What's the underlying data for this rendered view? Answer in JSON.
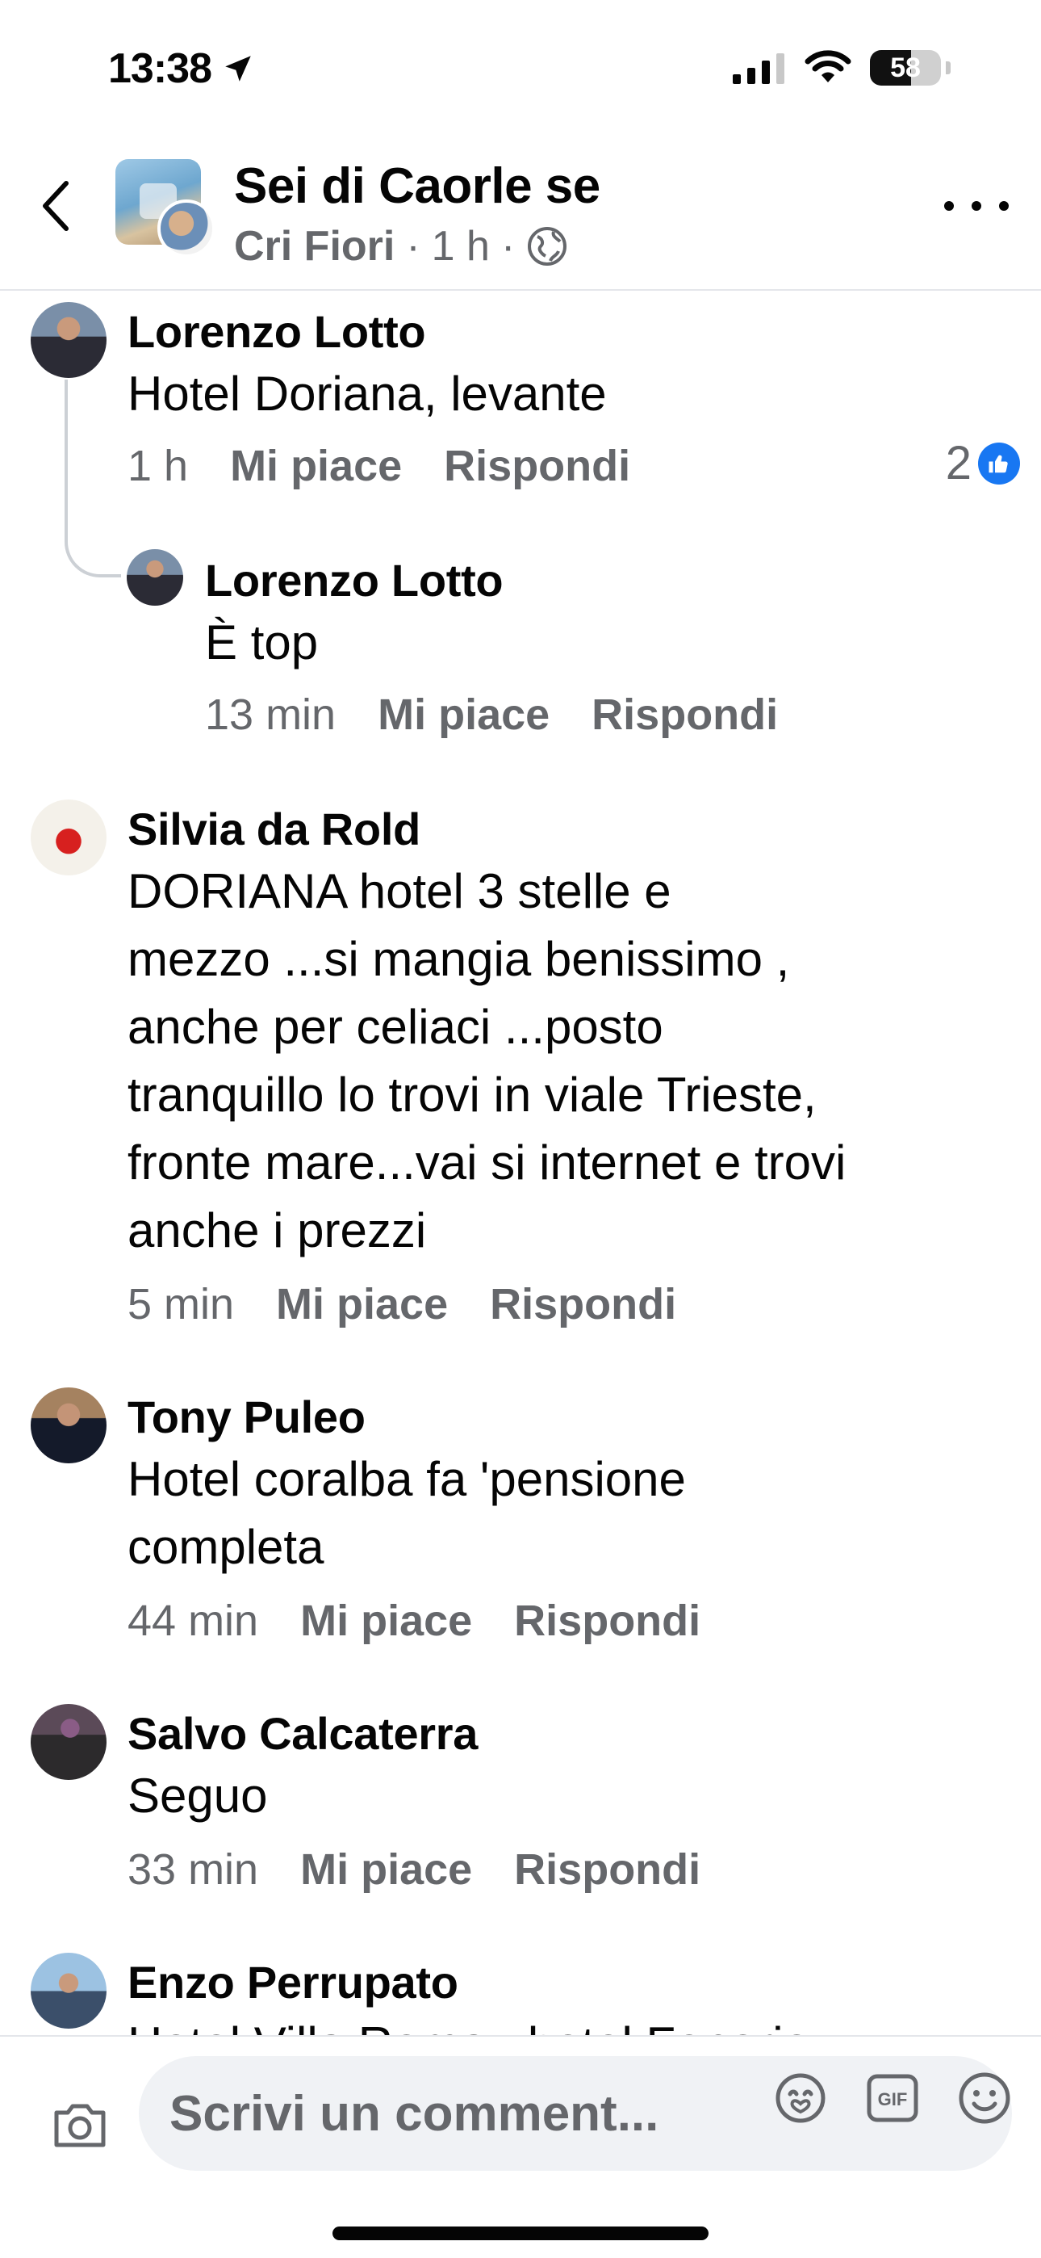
{
  "status_bar": {
    "time": "13:38",
    "battery": "58",
    "battery_level": 0.58
  },
  "header": {
    "group_name": "Sei di Caorle se",
    "author": "Cri Fiori",
    "age": "1 h",
    "separator": "·",
    "privacy_icon": "globe-icon"
  },
  "comments": [
    {
      "name": "Lorenzo Lotto",
      "text": "Hotel Doriana, levante",
      "time": "1 h",
      "like": "Mi piace",
      "reply": "Rispondi",
      "reaction_count": "2",
      "reaction_icon": "like-icon"
    },
    {
      "name": "Lorenzo Lotto",
      "text": "È top",
      "time": "13 min",
      "like": "Mi piace",
      "reply": "Rispondi"
    },
    {
      "name": "Silvia da Rold",
      "text": "DORIANA hotel 3 stelle e\nmezzo ...si mangia benissimo ,\nanche per celiaci ...posto\ntranquillo lo trovi in viale Trieste,\nfronte mare...vai si internet e trovi\nanche i  prezzi",
      "time": "5 min",
      "like": "Mi piace",
      "reply": "Rispondi"
    },
    {
      "name": "Tony Puleo",
      "text": "Hotel coralba fa 'pensione\ncompleta",
      "time": "44 min",
      "like": "Mi piace",
      "reply": "Rispondi"
    },
    {
      "name": "Salvo Calcaterra",
      "text": "Seguo",
      "time": "33 min",
      "like": "Mi piace",
      "reply": "Rispondi"
    },
    {
      "name": "Enzo Perrupato",
      "text": "Hotel Villa Roma , hotel Fenorio"
    }
  ],
  "composer": {
    "placeholder": "Scrivi un comment...",
    "icons": [
      "camera-icon",
      "avatar-sticker-icon",
      "gif-icon",
      "emoji-icon"
    ]
  },
  "colors": {
    "primary_text": "#050505",
    "secondary_text": "#65676b",
    "like_blue": "#1877f2",
    "input_bg": "#f0f2f5"
  }
}
